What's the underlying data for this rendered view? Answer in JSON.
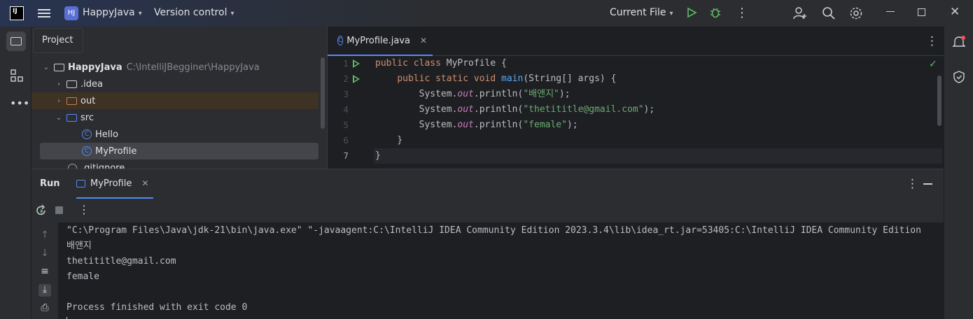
{
  "titlebar": {
    "logo_text": "IJ",
    "project_badge": "HJ",
    "project_name": "HappyJava",
    "version_control": "Version control",
    "run_config": "Current File"
  },
  "project_panel": {
    "tab_label": "Project",
    "tree": [
      {
        "label": "HappyJava",
        "path": "C:\\IntelliJBegginer\\HappyJava"
      },
      {
        "label": ".idea"
      },
      {
        "label": "out"
      },
      {
        "label": "src"
      },
      {
        "label": "Hello"
      },
      {
        "label": "MyProfile"
      },
      {
        "label": ".gitignore"
      }
    ]
  },
  "editor": {
    "tab_label": "MyProfile.java",
    "line_numbers": [
      "1",
      "2",
      "3",
      "4",
      "5",
      "6",
      "7"
    ],
    "code": {
      "l1_kw": "public class ",
      "l1_name": "MyProfile {",
      "l2_indent": "    ",
      "l2_kw": "public static void ",
      "l2_fn": "main",
      "l2_rest": "(String[] args) {",
      "print_prefix": "        System.",
      "print_out": "out",
      "print_call": ".println(",
      "l3_str": "\"배앤지\"",
      "l4_str": "\"thetititle@gmail.com\"",
      "l5_str": "\"female\"",
      "print_end": ");",
      "l6": "    }",
      "l7": "}"
    }
  },
  "run_panel": {
    "title": "Run",
    "tab_label": "MyProfile",
    "console": [
      "\"C:\\Program Files\\Java\\jdk-21\\bin\\java.exe\" \"-javaagent:C:\\IntelliJ IDEA Community Edition 2023.3.4\\lib\\idea_rt.jar=53405:C:\\IntelliJ IDEA Community Edition",
      "배앤지",
      "thetititle@gmail.com",
      "female",
      "",
      "Process finished with exit code 0"
    ]
  },
  "colors": {
    "accent": "#548af7",
    "run_green": "#5fb865",
    "keyword": "#cf8e6d",
    "string": "#6aab73",
    "function": "#56a8f5"
  }
}
